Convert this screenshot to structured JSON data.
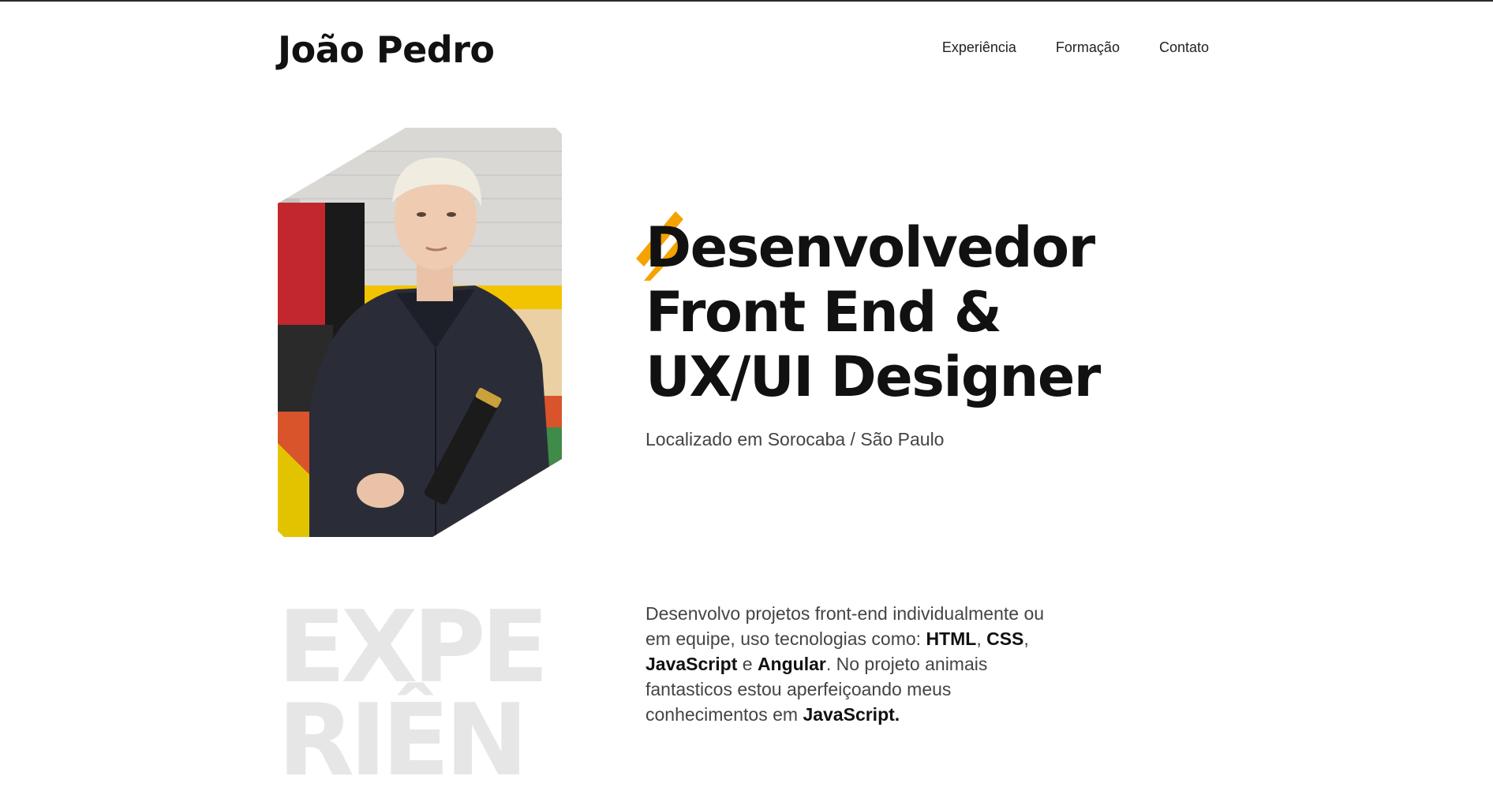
{
  "header": {
    "logo": "João Pedro",
    "nav": [
      {
        "label": "Experiência"
      },
      {
        "label": "Formação"
      },
      {
        "label": "Contato"
      }
    ]
  },
  "hero": {
    "title_lines": [
      "Desenvolvedor",
      "Front End &",
      "UX/UI Designer"
    ],
    "location": "Localizado em Sorocaba / São Paulo",
    "accent_color": "#f5a300"
  },
  "experience": {
    "background_word_lines": [
      "EXPE",
      "RIÊN"
    ],
    "description": {
      "t1": "Desenvolvo projetos front-end individualmente ou em equipe, uso tecnologias como: ",
      "b1": "HTML",
      "t2": ", ",
      "b2": "CSS",
      "t3": ", ",
      "b3": "JavaScript",
      "t4": " e ",
      "b4": "Angular",
      "t5": ". No projeto animais fantasticos estou aperfeiçoando meus conhecimentos em ",
      "b5": "JavaScript."
    }
  }
}
